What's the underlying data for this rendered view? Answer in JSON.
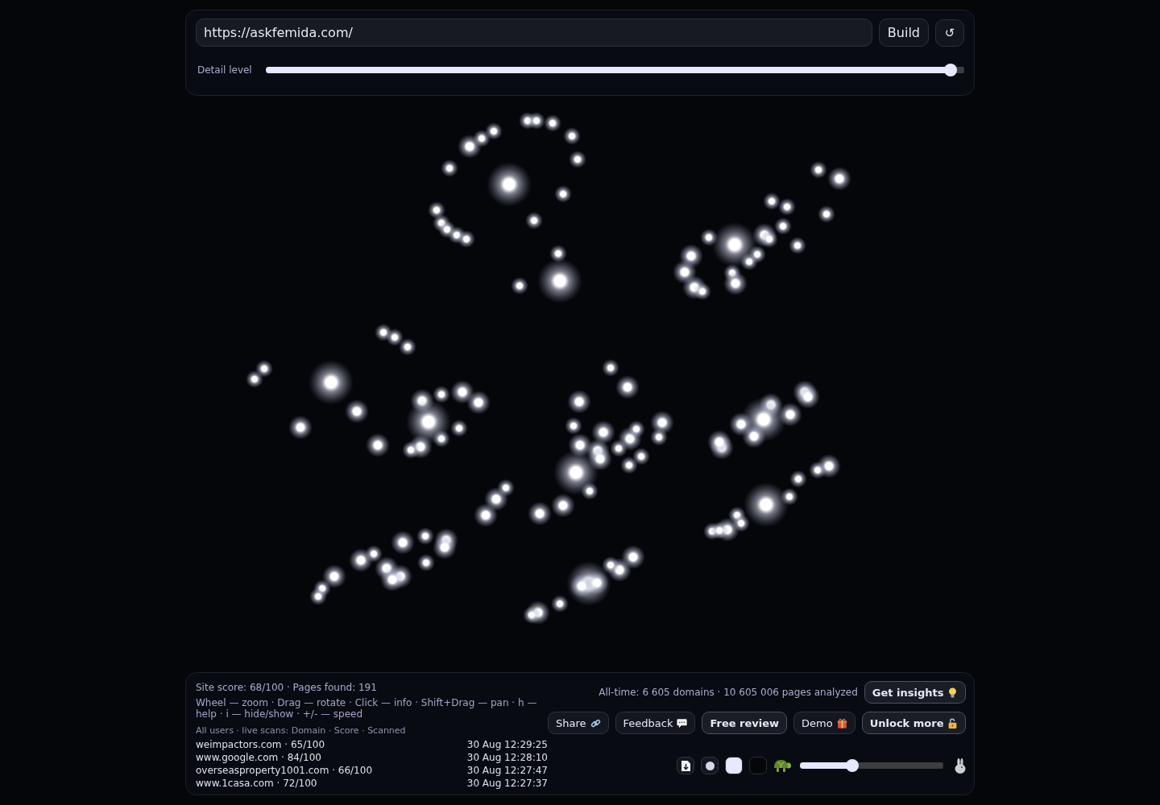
{
  "url_bar": {
    "value": "https://askfemida.com/",
    "build_button": "Build",
    "refresh_button": "↺"
  },
  "detail": {
    "label": "Detail level",
    "level": 0.98
  },
  "status": {
    "summary": "Site score: 68/100 · Pages found: 191",
    "help": "Wheel — zoom · Drag — rotate · Click — info · Shift+Drag — pan · h — help · i — hide/show · +/- — speed",
    "live_header": "All users · live scans: Domain · Score · Scanned",
    "scans": [
      {
        "site": "weimpactors.com · 65/100",
        "scanned": "30 Aug 12:29:25"
      },
      {
        "site": "www.google.com · 84/100",
        "scanned": "30 Aug 12:28:10"
      },
      {
        "site": "overseasproperty1001.com · 66/100",
        "scanned": "30 Aug 12:27:47"
      },
      {
        "site": "www.1casa.com · 72/100",
        "scanned": "30 Aug 12:27:37"
      }
    ]
  },
  "actions": {
    "all_time": "All-time: 6 605 domains · 10 605 006 pages analyzed",
    "header_button": {
      "label": "Get insights",
      "kind": "insights",
      "primary": true
    },
    "buttons": [
      {
        "label": "Share",
        "kind": "share",
        "primary": false
      },
      {
        "label": "Feedback",
        "kind": "feedback",
        "primary": false
      },
      {
        "label": "Free review",
        "kind": "review",
        "primary": true
      },
      {
        "label": "Demo",
        "kind": "demo",
        "primary": false
      },
      {
        "label": "Unlock more",
        "kind": "unlock",
        "primary": true
      }
    ]
  },
  "view_controls": {
    "swatches": [
      {
        "color": "#e6e9ff"
      },
      {
        "color": "#05060a"
      }
    ],
    "speed": {
      "level": 0.365
    }
  }
}
